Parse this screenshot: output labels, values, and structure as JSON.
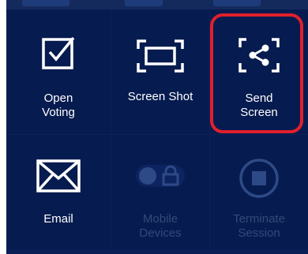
{
  "menu": {
    "tiles": [
      {
        "label": "Open\nVoting",
        "icon": "checkbox-icon",
        "enabled": true
      },
      {
        "label": "Screen Shot",
        "icon": "screenshot-frame-icon",
        "enabled": true
      },
      {
        "label": "Send\nScreen",
        "icon": "share-screen-icon",
        "enabled": true
      },
      {
        "label": "Email",
        "icon": "envelope-icon",
        "enabled": true
      },
      {
        "label": "Mobile\nDevices",
        "icon": "toggle-lock-icon",
        "enabled": false
      },
      {
        "label": "Terminate\nSession",
        "icon": "stop-circle-icon",
        "enabled": false
      }
    ]
  },
  "colors": {
    "background": "#031644",
    "tile": "#061b4f",
    "highlight": "#e0202c",
    "disabled": "#34497a"
  }
}
